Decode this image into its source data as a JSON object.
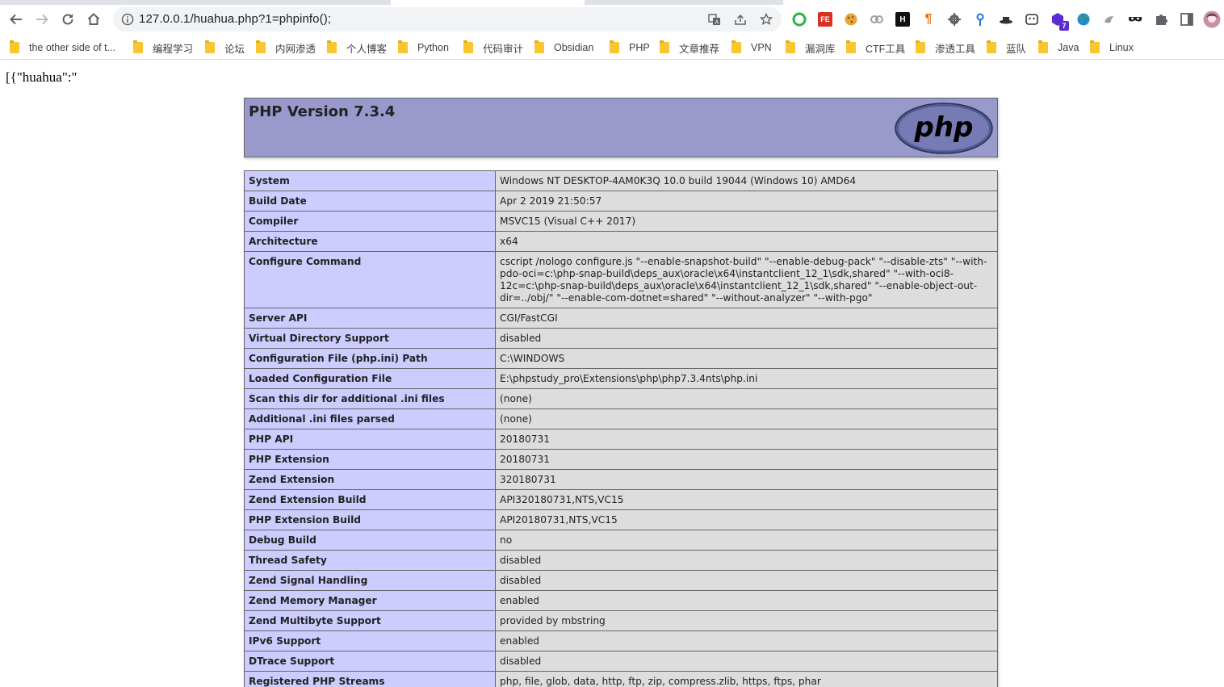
{
  "browser": {
    "url": "127.0.0.1/huahua.php?1=phpinfo();",
    "bookmarks": [
      "the other side of t...",
      "编程学习",
      "论坛",
      "内网渗透",
      "个人博客",
      "Python",
      "代码审计",
      "Obsidian",
      "PHP",
      "文章推荐",
      "VPN",
      "漏洞库",
      "CTF工具",
      "渗透工具",
      "蓝队",
      "Java",
      "Linux"
    ],
    "extension_badge": "7"
  },
  "page": {
    "echo_text": "[{\"huahua\":\"",
    "php_title": "PHP Version 7.3.4",
    "logo_text": "php",
    "rows": [
      {
        "label": "System",
        "value": "Windows NT DESKTOP-4AM0K3Q 10.0 build 19044 (Windows 10) AMD64"
      },
      {
        "label": "Build Date",
        "value": "Apr 2 2019 21:50:57"
      },
      {
        "label": "Compiler",
        "value": "MSVC15 (Visual C++ 2017)"
      },
      {
        "label": "Architecture",
        "value": "x64"
      },
      {
        "label": "Configure Command",
        "value": "cscript /nologo configure.js \"--enable-snapshot-build\" \"--enable-debug-pack\" \"--disable-zts\" \"--with-pdo-oci=c:\\php-snap-build\\deps_aux\\oracle\\x64\\instantclient_12_1\\sdk,shared\" \"--with-oci8-12c=c:\\php-snap-build\\deps_aux\\oracle\\x64\\instantclient_12_1\\sdk,shared\" \"--enable-object-out-dir=../obj/\" \"--enable-com-dotnet=shared\" \"--without-analyzer\" \"--with-pgo\""
      },
      {
        "label": "Server API",
        "value": "CGI/FastCGI"
      },
      {
        "label": "Virtual Directory Support",
        "value": "disabled"
      },
      {
        "label": "Configuration File (php.ini) Path",
        "value": "C:\\WINDOWS"
      },
      {
        "label": "Loaded Configuration File",
        "value": "E:\\phpstudy_pro\\Extensions\\php\\php7.3.4nts\\php.ini"
      },
      {
        "label": "Scan this dir for additional .ini files",
        "value": "(none)"
      },
      {
        "label": "Additional .ini files parsed",
        "value": "(none)"
      },
      {
        "label": "PHP API",
        "value": "20180731"
      },
      {
        "label": "PHP Extension",
        "value": "20180731"
      },
      {
        "label": "Zend Extension",
        "value": "320180731"
      },
      {
        "label": "Zend Extension Build",
        "value": "API320180731,NTS,VC15"
      },
      {
        "label": "PHP Extension Build",
        "value": "API20180731,NTS,VC15"
      },
      {
        "label": "Debug Build",
        "value": "no"
      },
      {
        "label": "Thread Safety",
        "value": "disabled"
      },
      {
        "label": "Zend Signal Handling",
        "value": "disabled"
      },
      {
        "label": "Zend Memory Manager",
        "value": "enabled"
      },
      {
        "label": "Zend Multibyte Support",
        "value": "provided by mbstring"
      },
      {
        "label": "IPv6 Support",
        "value": "enabled"
      },
      {
        "label": "DTrace Support",
        "value": "disabled"
      },
      {
        "label": "Registered PHP Streams",
        "value": "php, file, glob, data, http, ftp, zip, compress.zlib, https, ftps, phar"
      }
    ]
  },
  "colors": {
    "header_bg": "#9999cc",
    "label_bg": "#ccccff",
    "value_bg": "#dddddd",
    "folder": "#f9c630"
  }
}
